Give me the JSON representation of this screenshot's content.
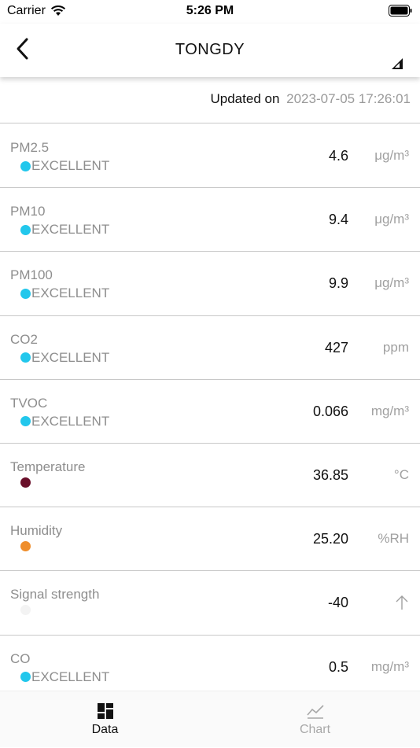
{
  "status_bar": {
    "carrier": "Carrier",
    "time": "5:26 PM"
  },
  "nav": {
    "title": "TONGDY"
  },
  "updated": {
    "label": "Updated on",
    "value": "2023-07-05 17:26:01"
  },
  "colors": {
    "excellent": "#22c7ec",
    "temperature": "#6a0f2a",
    "humidity": "#ef8e2c",
    "signal": "#f3f3f3"
  },
  "rows": [
    {
      "name": "PM2.5",
      "status": "EXCELLENT",
      "dot": "#22c7ec",
      "value": "4.6",
      "unit": "μg/m³"
    },
    {
      "name": "PM10",
      "status": "EXCELLENT",
      "dot": "#22c7ec",
      "value": "9.4",
      "unit": "μg/m³"
    },
    {
      "name": "PM100",
      "status": "EXCELLENT",
      "dot": "#22c7ec",
      "value": "9.9",
      "unit": "μg/m³"
    },
    {
      "name": "CO2",
      "status": "EXCELLENT",
      "dot": "#22c7ec",
      "value": "427",
      "unit": "ppm"
    },
    {
      "name": "TVOC",
      "status": "EXCELLENT",
      "dot": "#22c7ec",
      "value": "0.066",
      "unit": "mg/m³"
    },
    {
      "name": "Temperature",
      "status": "",
      "dot": "#6a0f2a",
      "value": "36.85",
      "unit": "°C"
    },
    {
      "name": "Humidity",
      "status": "",
      "dot": "#ef8e2c",
      "value": "25.20",
      "unit": "%RH"
    },
    {
      "name": "Signal strength",
      "status": "",
      "dot": "#f3f3f3",
      "value": "-40",
      "unit": "",
      "unit_icon": "arrow-up-icon"
    },
    {
      "name": "CO",
      "status": "EXCELLENT",
      "dot": "#22c7ec",
      "value": "0.5",
      "unit": "mg/m³"
    }
  ],
  "tabs": [
    {
      "label": "Data",
      "icon": "dashboard-icon",
      "active": true
    },
    {
      "label": "Chart",
      "icon": "chart-icon",
      "active": false
    }
  ]
}
